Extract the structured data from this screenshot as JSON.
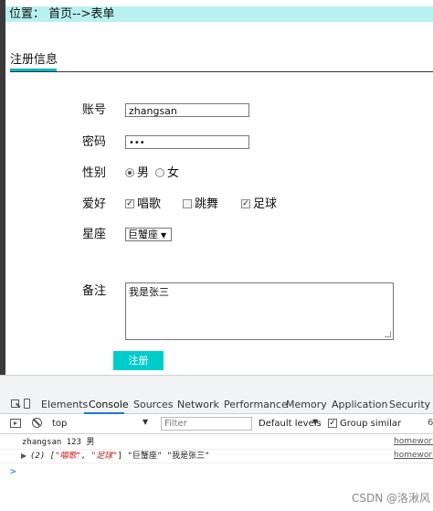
{
  "breadcrumb": "位置： 首页-->表单",
  "section_title": "注册信息",
  "form": {
    "account_label": "账号",
    "account_value": "zhangsan",
    "password_label": "密码",
    "password_mask": "•••",
    "gender_label": "性别",
    "gender_options": [
      "男",
      "女"
    ],
    "gender_selected": "男",
    "hobby_label": "爱好",
    "hobbies": [
      {
        "label": "唱歌",
        "checked": true
      },
      {
        "label": "跳舞",
        "checked": false
      },
      {
        "label": "足球",
        "checked": true
      }
    ],
    "constellation_label": "星座",
    "constellation_value": "巨蟹座",
    "remark_label": "备注",
    "remark_value": "我是张三",
    "submit_label": "注册"
  },
  "devtools": {
    "tabs": [
      "Elements",
      "Console",
      "Sources",
      "Network",
      "Performance",
      "Memory",
      "Application",
      "Security"
    ],
    "active_tab": "Console",
    "context": "top",
    "filter_placeholder": "Filter",
    "levels": "Default levels",
    "group_similar": "Group similar",
    "settings_fragment": "6",
    "logs": [
      {
        "text": "zhangsan 123 男",
        "source": "homework"
      },
      {
        "prefix": "(2) [",
        "items": [
          "\"唱歌\"",
          "\"足球\""
        ],
        "suffix": "] \"巨蟹座\" \"我是张三\"",
        "source": "homework"
      }
    ],
    "prompt": ">"
  },
  "watermark": "CSDN @洛湫风",
  "colors": {
    "breadcrumb_bg": "#b9f1f1",
    "accent": "#00cccc",
    "tab_active": "#1a73e8"
  }
}
